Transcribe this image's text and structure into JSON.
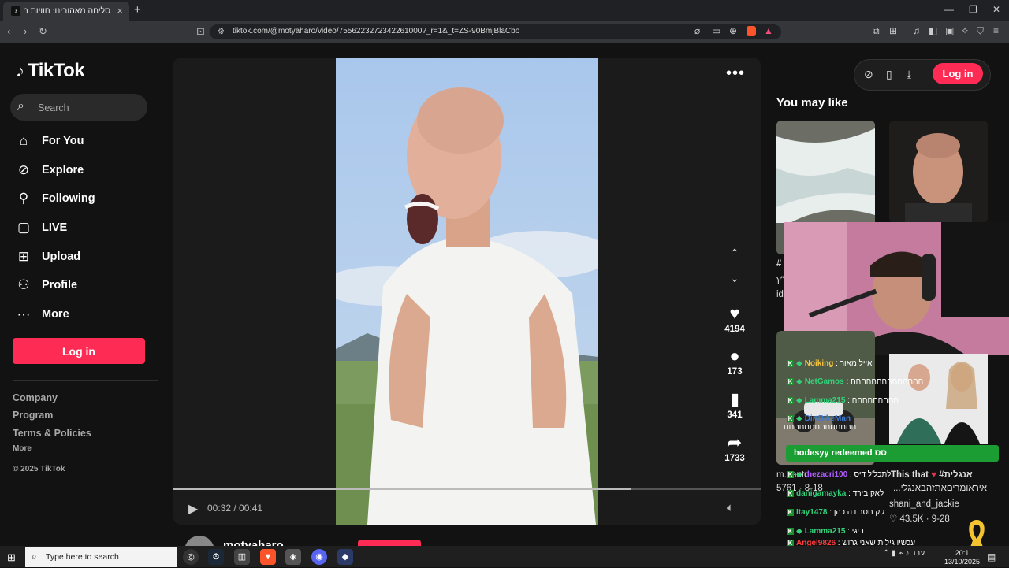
{
  "browser": {
    "tab_title": "סליחה מאהובינו: חוויות מרגשות",
    "tab_close": "×",
    "new_tab": "+",
    "url": "tiktok.com/@motyaharo/video/7556223272342261000?_r=1&_t=ZS-90BmjBlaCbo",
    "window_minimize": "—",
    "window_maximize": "❐",
    "window_close": "✕"
  },
  "sidebar": {
    "logo_text": "TikTok",
    "search_placeholder": "Search",
    "nav": [
      {
        "label": "For You",
        "icon": "home-icon"
      },
      {
        "label": "Explore",
        "icon": "compass-icon"
      },
      {
        "label": "Following",
        "icon": "user-follow-icon"
      },
      {
        "label": "LIVE",
        "icon": "live-tv-icon"
      },
      {
        "label": "Upload",
        "icon": "plus-square-icon"
      },
      {
        "label": "Profile",
        "icon": "person-icon"
      },
      {
        "label": "More",
        "icon": "ellipsis-icon"
      }
    ],
    "login_label": "Log in",
    "footer": {
      "company": "Company",
      "program": "Program",
      "terms": "Terms & Policies",
      "more": "More",
      "copyright": "© 2025 TikTok"
    }
  },
  "video": {
    "likes": "4194",
    "comments": "173",
    "saves": "341",
    "shares": "1733",
    "time": "00:32 / 00:41",
    "progress": 0.78,
    "author": "motyaharo"
  },
  "right_panel": {
    "login_label": "Log in",
    "title": "You may like",
    "card_a_meta_partial": "#",
    "card_a_line2": "י\"ץ",
    "card_a_line3": "id",
    "card_c_meta_user": "m...auto",
    "card_c_likes": "5761 · 8-18",
    "card_d_title": "#אנגלית",
    "card_d_title2": "איראומריםאתזהבאנגלי...",
    "card_d_user": "shani_and_jackie",
    "card_d_likes": "43.5K · 9-28",
    "this_that": "This that"
  },
  "overlay_chat": {
    "redeem_text": "hodesyy redeemed סס",
    "lines": [
      {
        "name": "Noiking",
        "msg": "אייל מאור",
        "color": "#f5c542"
      },
      {
        "name": "NetGamos",
        "msg": "חחחחחחחחחחחחחח",
        "color": "#33d17a"
      },
      {
        "name": "Lamma215",
        "msg": "חחחחחחחחח",
        "color": "#33d17a"
      },
      {
        "name": "DirtBikeMan",
        "msg": "חחחחחחחחחחחחחח",
        "color": "#3c7bd6"
      },
      {
        "name": "thezacri100",
        "msg": "לתכל'ל דיס",
        "color": "#b05cff"
      },
      {
        "name": "danigamayka",
        "msg": "לאק בירד",
        "color": "#33d17a"
      },
      {
        "name": "Itay1478",
        "msg": "קק חסר דה כהן",
        "color": "#33d17a"
      },
      {
        "name": "Lamma215",
        "msg": "ביגי",
        "color": "#33d17a"
      },
      {
        "name": "Angel9826",
        "msg": "עכשיו גילית שאני גרוש",
        "color": "#ff3b3b"
      }
    ]
  },
  "taskbar": {
    "search_placeholder": "Type here to search",
    "lang": "עבר",
    "time": "20:1",
    "date": "13/10/2025"
  },
  "colors": {
    "accent": "#fe2c55",
    "bg": "#121212",
    "chat_green": "#1c9d34"
  }
}
